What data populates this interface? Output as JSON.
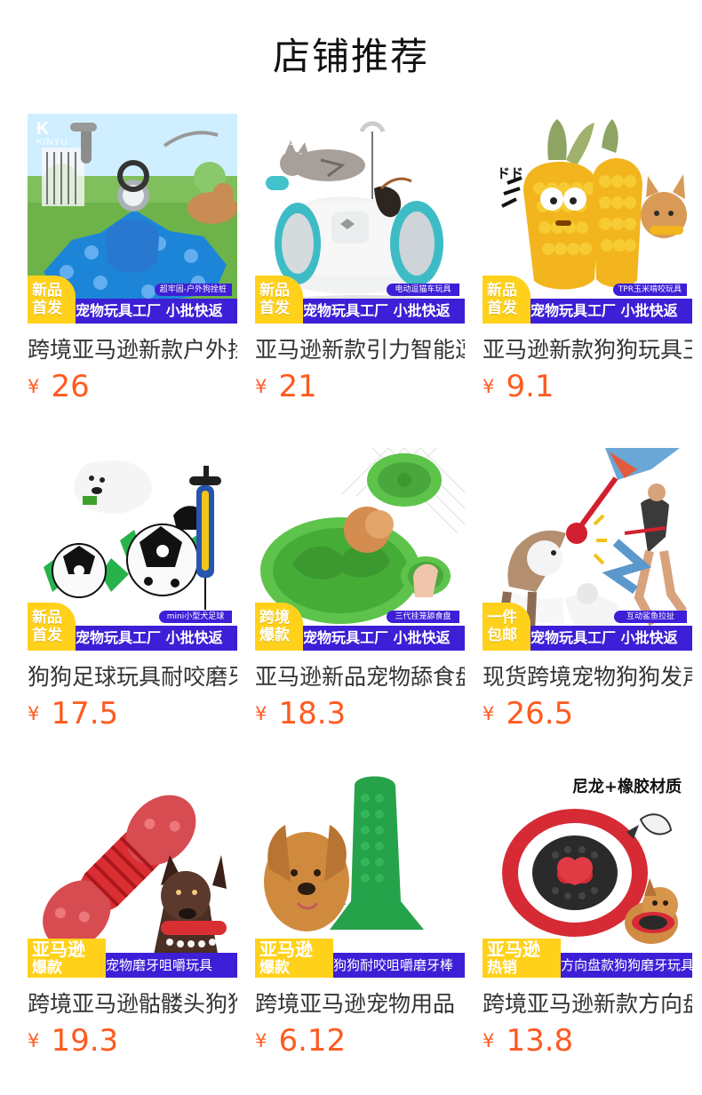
{
  "page": {
    "title": "店铺推荐"
  },
  "brand": {
    "name": "KINYU"
  },
  "common": {
    "bottom_bar": "宠物玩具工厂 小批快返"
  },
  "products": [
    {
      "name": "跨境亚马逊新款户外拴狗桩",
      "price": "26",
      "badge": "新品\n首发",
      "tag": "超牢固-户外狗拴桩",
      "accent": "#3c1fd6"
    },
    {
      "name": "亚马逊新款引力智能逗猫车",
      "price": "21",
      "badge": "新品\n首发",
      "tag": "电动逗猫车玩具",
      "accent": "#3c1fd6"
    },
    {
      "name": "亚马逊新款狗狗玩具玉米",
      "price": "9.1",
      "badge": "新品\n首发",
      "tag": "TPR玉米啃咬玩具",
      "accent": "#3c1fd6"
    },
    {
      "name": "狗狗足球玩具耐咬磨牙",
      "price": "17.5",
      "badge": "新品\n首发",
      "tag": "mini小型犬足球",
      "accent": "#3c1fd6"
    },
    {
      "name": "亚马逊新品宠物舔食盘",
      "price": "18.3",
      "badge": "跨境\n爆款",
      "tag": "三代挂笼舔食盘",
      "accent": "#3c1fd6"
    },
    {
      "name": "现货跨境宠物狗狗发声鲨鱼",
      "price": "26.5",
      "badge": "一件\n包邮",
      "tag": "互动鲨鱼拉扯",
      "accent": "#3c1fd6"
    },
    {
      "name": "跨境亚马逊骷髅头狗狗玩具",
      "price": "19.3",
      "badge_big": "亚马逊",
      "badge_small": "爆款",
      "bar": "宠物磨牙咀嚼玩具",
      "accent": "#3c1fd6"
    },
    {
      "name": "跨境亚马逊宠物用品",
      "price": "6.12",
      "badge_big": "亚马逊",
      "badge_small": "爆款",
      "bar": "狗狗耐咬咀嚼磨牙棒",
      "accent": "#3c1fd6"
    },
    {
      "name": "跨境亚马逊新款方向盘",
      "price": "13.8",
      "badge_big": "亚马逊",
      "badge_small": "热销",
      "bar": "方向盘款狗狗磨牙玩具",
      "headline": "尼龙+橡胶材质",
      "accent": "#3c1fd6"
    }
  ]
}
